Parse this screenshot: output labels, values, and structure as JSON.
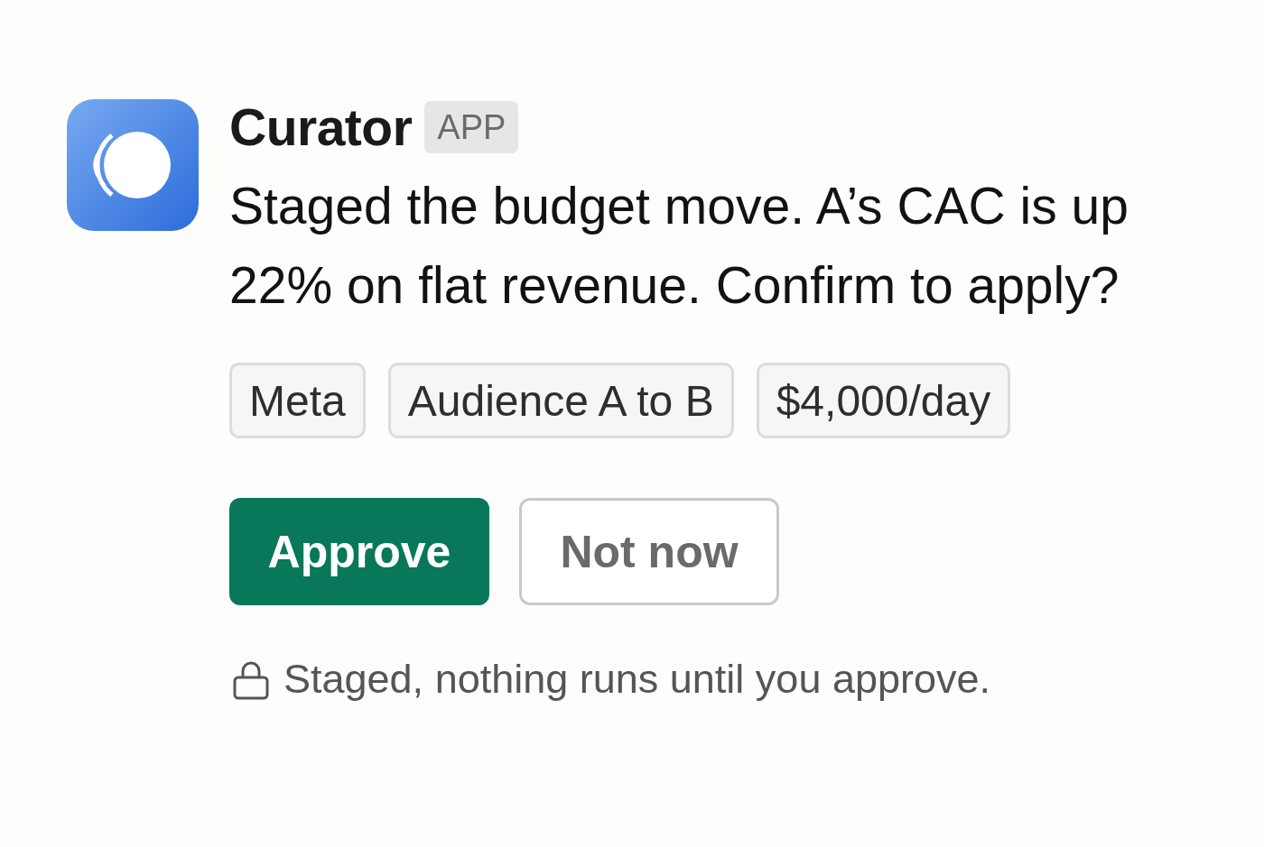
{
  "app": {
    "name": "Curator",
    "badge": "APP"
  },
  "message": "Staged the budget move. A’s CAC is up 22% on flat revenue. Confirm to apply?",
  "chips": [
    "Meta",
    "Audience A to B",
    "$4,000/day"
  ],
  "actions": [
    {
      "label": "Approve",
      "kind": "primary"
    },
    {
      "label": "Not now",
      "kind": "secondary"
    }
  ],
  "note": "Staged, nothing runs until you approve."
}
